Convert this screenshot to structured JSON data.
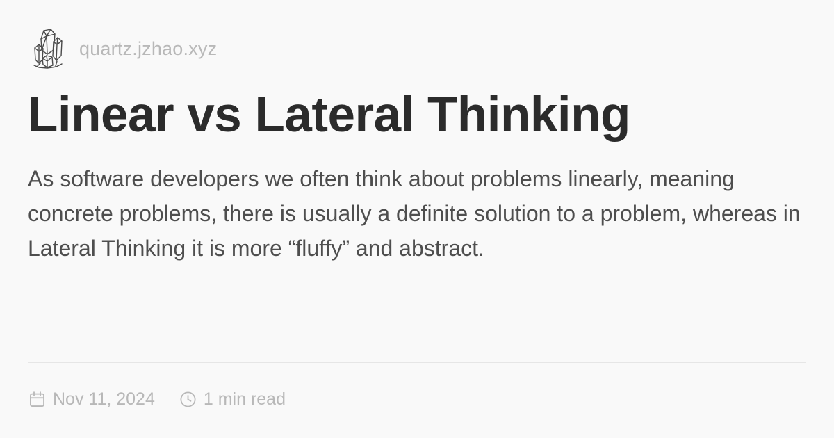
{
  "header": {
    "logo_icon": "crystal-logo-icon",
    "site_name": "quartz.jzhao.xyz"
  },
  "article": {
    "title": "Linear vs Lateral Thinking",
    "description": "As software developers we often think about problems linearly, meaning concrete problems, there is usually a definite solution to a problem, whereas in Lateral Thinking it is more “fluffy” and abstract."
  },
  "meta": {
    "date_icon": "calendar-icon",
    "date": "Nov 11, 2024",
    "reading_time_icon": "clock-icon",
    "reading_time": "1 min read"
  },
  "colors": {
    "background": "#f9f9f9",
    "title": "#2b2b2b",
    "body_text": "#4e4e4e",
    "muted": "#b8b8b8",
    "divider": "#e6e6e6"
  }
}
